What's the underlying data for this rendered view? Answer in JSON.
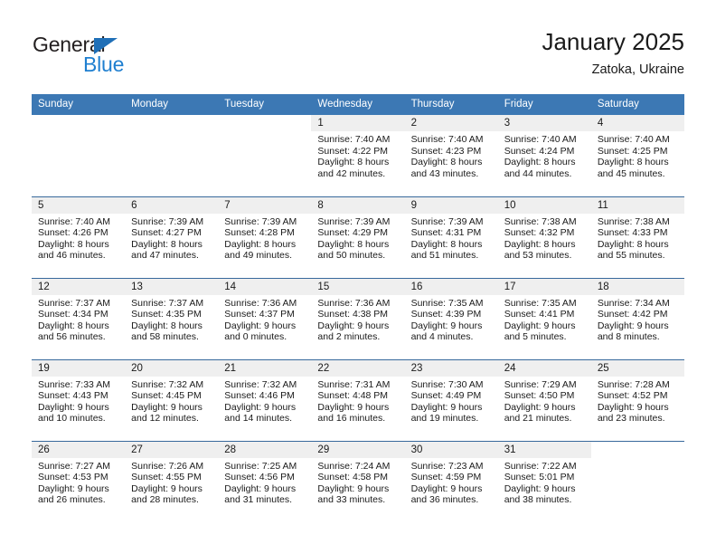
{
  "brand": {
    "name_part1": "General",
    "name_part2": "Blue",
    "triangle_icon": "triangle-icon",
    "accent_color": "#1f7fd0",
    "dark_color": "#231f20"
  },
  "header": {
    "title": "January 2025",
    "location": "Zatoka, Ukraine"
  },
  "theme": {
    "header_bar_color": "#3c78b4",
    "daynum_band_color": "#efefef",
    "row_divider_color": "#38699c",
    "text_color": "#1a1a1a"
  },
  "weekday_headers": [
    "Sunday",
    "Monday",
    "Tuesday",
    "Wednesday",
    "Thursday",
    "Friday",
    "Saturday"
  ],
  "weeks": [
    [
      {
        "day": "",
        "blank": true,
        "lines": []
      },
      {
        "day": "",
        "blank": true,
        "lines": []
      },
      {
        "day": "",
        "blank": true,
        "lines": []
      },
      {
        "day": "1",
        "lines": [
          "Sunrise: 7:40 AM",
          "Sunset: 4:22 PM",
          "Daylight: 8 hours",
          "and 42 minutes."
        ]
      },
      {
        "day": "2",
        "lines": [
          "Sunrise: 7:40 AM",
          "Sunset: 4:23 PM",
          "Daylight: 8 hours",
          "and 43 minutes."
        ]
      },
      {
        "day": "3",
        "lines": [
          "Sunrise: 7:40 AM",
          "Sunset: 4:24 PM",
          "Daylight: 8 hours",
          "and 44 minutes."
        ]
      },
      {
        "day": "4",
        "lines": [
          "Sunrise: 7:40 AM",
          "Sunset: 4:25 PM",
          "Daylight: 8 hours",
          "and 45 minutes."
        ]
      }
    ],
    [
      {
        "day": "5",
        "lines": [
          "Sunrise: 7:40 AM",
          "Sunset: 4:26 PM",
          "Daylight: 8 hours",
          "and 46 minutes."
        ]
      },
      {
        "day": "6",
        "lines": [
          "Sunrise: 7:39 AM",
          "Sunset: 4:27 PM",
          "Daylight: 8 hours",
          "and 47 minutes."
        ]
      },
      {
        "day": "7",
        "lines": [
          "Sunrise: 7:39 AM",
          "Sunset: 4:28 PM",
          "Daylight: 8 hours",
          "and 49 minutes."
        ]
      },
      {
        "day": "8",
        "lines": [
          "Sunrise: 7:39 AM",
          "Sunset: 4:29 PM",
          "Daylight: 8 hours",
          "and 50 minutes."
        ]
      },
      {
        "day": "9",
        "lines": [
          "Sunrise: 7:39 AM",
          "Sunset: 4:31 PM",
          "Daylight: 8 hours",
          "and 51 minutes."
        ]
      },
      {
        "day": "10",
        "lines": [
          "Sunrise: 7:38 AM",
          "Sunset: 4:32 PM",
          "Daylight: 8 hours",
          "and 53 minutes."
        ]
      },
      {
        "day": "11",
        "lines": [
          "Sunrise: 7:38 AM",
          "Sunset: 4:33 PM",
          "Daylight: 8 hours",
          "and 55 minutes."
        ]
      }
    ],
    [
      {
        "day": "12",
        "lines": [
          "Sunrise: 7:37 AM",
          "Sunset: 4:34 PM",
          "Daylight: 8 hours",
          "and 56 minutes."
        ]
      },
      {
        "day": "13",
        "lines": [
          "Sunrise: 7:37 AM",
          "Sunset: 4:35 PM",
          "Daylight: 8 hours",
          "and 58 minutes."
        ]
      },
      {
        "day": "14",
        "lines": [
          "Sunrise: 7:36 AM",
          "Sunset: 4:37 PM",
          "Daylight: 9 hours",
          "and 0 minutes."
        ]
      },
      {
        "day": "15",
        "lines": [
          "Sunrise: 7:36 AM",
          "Sunset: 4:38 PM",
          "Daylight: 9 hours",
          "and 2 minutes."
        ]
      },
      {
        "day": "16",
        "lines": [
          "Sunrise: 7:35 AM",
          "Sunset: 4:39 PM",
          "Daylight: 9 hours",
          "and 4 minutes."
        ]
      },
      {
        "day": "17",
        "lines": [
          "Sunrise: 7:35 AM",
          "Sunset: 4:41 PM",
          "Daylight: 9 hours",
          "and 5 minutes."
        ]
      },
      {
        "day": "18",
        "lines": [
          "Sunrise: 7:34 AM",
          "Sunset: 4:42 PM",
          "Daylight: 9 hours",
          "and 8 minutes."
        ]
      }
    ],
    [
      {
        "day": "19",
        "lines": [
          "Sunrise: 7:33 AM",
          "Sunset: 4:43 PM",
          "Daylight: 9 hours",
          "and 10 minutes."
        ]
      },
      {
        "day": "20",
        "lines": [
          "Sunrise: 7:32 AM",
          "Sunset: 4:45 PM",
          "Daylight: 9 hours",
          "and 12 minutes."
        ]
      },
      {
        "day": "21",
        "lines": [
          "Sunrise: 7:32 AM",
          "Sunset: 4:46 PM",
          "Daylight: 9 hours",
          "and 14 minutes."
        ]
      },
      {
        "day": "22",
        "lines": [
          "Sunrise: 7:31 AM",
          "Sunset: 4:48 PM",
          "Daylight: 9 hours",
          "and 16 minutes."
        ]
      },
      {
        "day": "23",
        "lines": [
          "Sunrise: 7:30 AM",
          "Sunset: 4:49 PM",
          "Daylight: 9 hours",
          "and 19 minutes."
        ]
      },
      {
        "day": "24",
        "lines": [
          "Sunrise: 7:29 AM",
          "Sunset: 4:50 PM",
          "Daylight: 9 hours",
          "and 21 minutes."
        ]
      },
      {
        "day": "25",
        "lines": [
          "Sunrise: 7:28 AM",
          "Sunset: 4:52 PM",
          "Daylight: 9 hours",
          "and 23 minutes."
        ]
      }
    ],
    [
      {
        "day": "26",
        "lines": [
          "Sunrise: 7:27 AM",
          "Sunset: 4:53 PM",
          "Daylight: 9 hours",
          "and 26 minutes."
        ]
      },
      {
        "day": "27",
        "lines": [
          "Sunrise: 7:26 AM",
          "Sunset: 4:55 PM",
          "Daylight: 9 hours",
          "and 28 minutes."
        ]
      },
      {
        "day": "28",
        "lines": [
          "Sunrise: 7:25 AM",
          "Sunset: 4:56 PM",
          "Daylight: 9 hours",
          "and 31 minutes."
        ]
      },
      {
        "day": "29",
        "lines": [
          "Sunrise: 7:24 AM",
          "Sunset: 4:58 PM",
          "Daylight: 9 hours",
          "and 33 minutes."
        ]
      },
      {
        "day": "30",
        "lines": [
          "Sunrise: 7:23 AM",
          "Sunset: 4:59 PM",
          "Daylight: 9 hours",
          "and 36 minutes."
        ]
      },
      {
        "day": "31",
        "lines": [
          "Sunrise: 7:22 AM",
          "Sunset: 5:01 PM",
          "Daylight: 9 hours",
          "and 38 minutes."
        ]
      },
      {
        "day": "",
        "blank": true,
        "lines": []
      }
    ]
  ]
}
